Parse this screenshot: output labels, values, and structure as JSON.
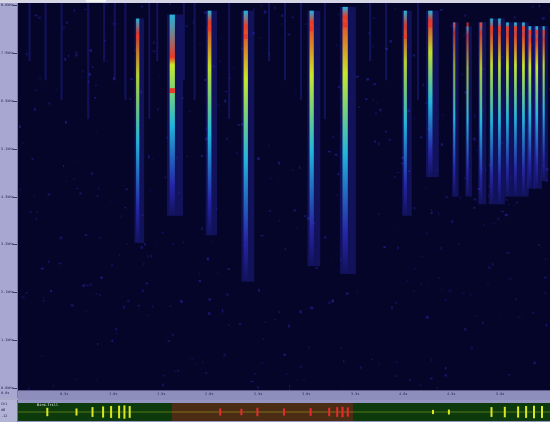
{
  "window": {
    "title": ""
  },
  "colors": {
    "background": "#05052a",
    "low": "#2a2ab8",
    "mid": "#22c8e8",
    "high": "#c8e828",
    "peak": "#e83a28",
    "waveform": "#d8e820",
    "waveform_selected": "#e82a2a",
    "overview_bg": "#0d3a0d"
  },
  "freq_axis": {
    "labels": [
      "8.6kHz",
      "7.9kHz",
      "6.5kHz",
      "5.1kHz",
      "4.3kHz",
      "3.3kHz",
      "2.1kHz",
      "1.1kHz",
      "0.0kHz"
    ]
  },
  "time_axis": {
    "labels": [
      "0.5s",
      "1.0s",
      "1.5s",
      "2.0s",
      "2.5s",
      "3.0s",
      "3.5s",
      "4.0s",
      "4.5s",
      "5.0s"
    ]
  },
  "corner": {
    "label": "0.0s"
  },
  "overview": {
    "label": "Bird-Trill",
    "side_labels": [
      "Ch1",
      "dB",
      "-12"
    ],
    "selection": {
      "start": 0.29,
      "end": 0.63
    }
  },
  "spectrogram": {
    "calls": [
      {
        "t": 0.225,
        "w": 0.006,
        "top": 0.04,
        "bottom": 0.62,
        "peak": 0.08,
        "intensity": 0.9
      },
      {
        "t": 0.29,
        "w": 0.01,
        "top": 0.03,
        "bottom": 0.55,
        "peak": 0.22,
        "intensity": 1.0
      },
      {
        "t": 0.36,
        "w": 0.007,
        "top": 0.02,
        "bottom": 0.6,
        "peak": 0.06,
        "intensity": 0.95
      },
      {
        "t": 0.428,
        "w": 0.008,
        "top": 0.02,
        "bottom": 0.72,
        "peak": 0.08,
        "intensity": 1.0
      },
      {
        "t": 0.552,
        "w": 0.008,
        "top": 0.02,
        "bottom": 0.68,
        "peak": 0.06,
        "intensity": 1.0
      },
      {
        "t": 0.615,
        "w": 0.01,
        "top": 0.01,
        "bottom": 0.7,
        "peak": 0.05,
        "intensity": 1.0
      },
      {
        "t": 0.728,
        "w": 0.006,
        "top": 0.02,
        "bottom": 0.55,
        "peak": 0.08,
        "intensity": 0.9
      },
      {
        "t": 0.775,
        "w": 0.008,
        "top": 0.02,
        "bottom": 0.45,
        "peak": 0.05,
        "intensity": 0.95
      },
      {
        "t": 0.82,
        "w": 0.004,
        "top": 0.05,
        "bottom": 0.5,
        "peak": 0.05,
        "intensity": 0.7
      },
      {
        "t": 0.845,
        "w": 0.004,
        "top": 0.06,
        "bottom": 0.5,
        "peak": 0.05,
        "intensity": 0.75
      },
      {
        "t": 0.87,
        "w": 0.005,
        "top": 0.05,
        "bottom": 0.52,
        "peak": 0.05,
        "intensity": 0.85
      },
      {
        "t": 0.89,
        "w": 0.005,
        "top": 0.04,
        "bottom": 0.52,
        "peak": 0.06,
        "intensity": 0.95
      },
      {
        "t": 0.905,
        "w": 0.005,
        "top": 0.04,
        "bottom": 0.52,
        "peak": 0.06,
        "intensity": 0.95
      },
      {
        "t": 0.92,
        "w": 0.005,
        "top": 0.05,
        "bottom": 0.5,
        "peak": 0.06,
        "intensity": 1.0
      },
      {
        "t": 0.935,
        "w": 0.005,
        "top": 0.05,
        "bottom": 0.5,
        "peak": 0.06,
        "intensity": 1.0
      },
      {
        "t": 0.95,
        "w": 0.005,
        "top": 0.05,
        "bottom": 0.5,
        "peak": 0.06,
        "intensity": 1.0
      },
      {
        "t": 0.962,
        "w": 0.005,
        "top": 0.06,
        "bottom": 0.48,
        "peak": 0.07,
        "intensity": 1.0
      },
      {
        "t": 0.975,
        "w": 0.005,
        "top": 0.06,
        "bottom": 0.48,
        "peak": 0.07,
        "intensity": 1.0
      },
      {
        "t": 0.988,
        "w": 0.004,
        "top": 0.06,
        "bottom": 0.46,
        "peak": 0.07,
        "intensity": 0.95
      }
    ],
    "faint_streaks": [
      0.02,
      0.05,
      0.08,
      0.13,
      0.16,
      0.18,
      0.2,
      0.245,
      0.26,
      0.31,
      0.33,
      0.395,
      0.47,
      0.5,
      0.53,
      0.575,
      0.66,
      0.69,
      0.75
    ]
  },
  "waveform": {
    "bursts": [
      {
        "t": 0.055,
        "amp": 0.6,
        "sel": false
      },
      {
        "t": 0.11,
        "amp": 0.5,
        "sel": false
      },
      {
        "t": 0.14,
        "amp": 0.7,
        "sel": false
      },
      {
        "t": 0.16,
        "amp": 0.8,
        "sel": false
      },
      {
        "t": 0.175,
        "amp": 0.85,
        "sel": false
      },
      {
        "t": 0.19,
        "amp": 0.9,
        "sel": false
      },
      {
        "t": 0.2,
        "amp": 0.95,
        "sel": false
      },
      {
        "t": 0.21,
        "amp": 0.85,
        "sel": false
      },
      {
        "t": 0.38,
        "amp": 0.5,
        "sel": true
      },
      {
        "t": 0.42,
        "amp": 0.45,
        "sel": true
      },
      {
        "t": 0.45,
        "amp": 0.6,
        "sel": true
      },
      {
        "t": 0.5,
        "amp": 0.5,
        "sel": true
      },
      {
        "t": 0.55,
        "amp": 0.55,
        "sel": true
      },
      {
        "t": 0.585,
        "amp": 0.6,
        "sel": true
      },
      {
        "t": 0.6,
        "amp": 0.7,
        "sel": true
      },
      {
        "t": 0.61,
        "amp": 0.75,
        "sel": true
      },
      {
        "t": 0.62,
        "amp": 0.65,
        "sel": true
      },
      {
        "t": 0.78,
        "amp": 0.3,
        "sel": false
      },
      {
        "t": 0.81,
        "amp": 0.35,
        "sel": false
      },
      {
        "t": 0.89,
        "amp": 0.7,
        "sel": false
      },
      {
        "t": 0.915,
        "amp": 0.75,
        "sel": false
      },
      {
        "t": 0.94,
        "amp": 0.8,
        "sel": false
      },
      {
        "t": 0.955,
        "amp": 0.85,
        "sel": false
      },
      {
        "t": 0.97,
        "amp": 0.9,
        "sel": false
      },
      {
        "t": 0.985,
        "amp": 0.85,
        "sel": false
      }
    ]
  }
}
